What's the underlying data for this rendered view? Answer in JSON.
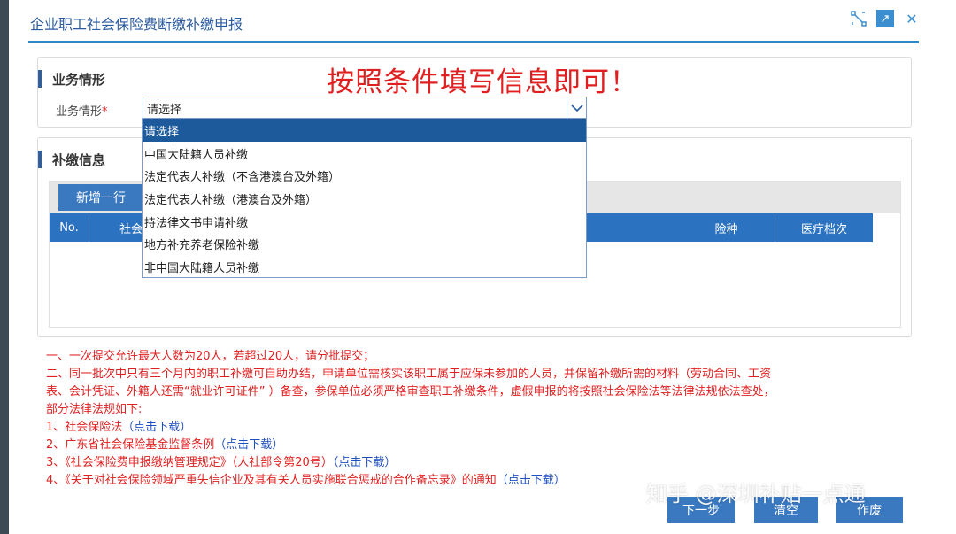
{
  "window": {
    "title": "企业职工社会保险费断缴补缴申报",
    "icons": [
      "resize-icon",
      "popout-icon",
      "close-icon"
    ]
  },
  "slogan": "按照条件填写信息即可！",
  "section1": {
    "title": "业务情形",
    "field_label": "业务情形",
    "required_mark": "*",
    "selected_value": "请选择",
    "options": [
      "请选择",
      "中国大陆籍人员补缴",
      "法定代表人补缴（不含港澳台及外籍）",
      "法定代表人补缴（港澳台及外籍）",
      "持法律文书申请补缴",
      "地方补充养老保险补缴",
      "非中国大陆籍人员补缴"
    ]
  },
  "section2": {
    "title": "补缴信息",
    "add_row_button": "新增一行",
    "columns": [
      "No.",
      "社会",
      "险种",
      "医疗档次"
    ]
  },
  "notes": {
    "line1": "一、一次提交允许最大人数为20人，若超过20人，请分批提交；",
    "line2a": "二、同一批次中只有三个月内的职工补缴可自助办结，申请单位需核实该职工属于应保未参加的人员，并保留补缴所需的材料（劳动合同、工资",
    "line2b": "表、会计凭证、外籍人还需“就业许可证件” ）备查，参保单位必须严格审查职工补缴条件，虚假申报的将按照社会保险法等法律法规依法查处，",
    "line2c": "部分法律法规如下:",
    "law1": "1、社会保险法",
    "law2": "2、广东省社会保险基金监督条例",
    "law3": "3、《社会保险费申报缴纳管理规定》（人社部令第20号）",
    "law4": "4、《关于对社会保险领域严重失信企业及其有关人员实施联合惩戒的合作备忘录》的通知",
    "download": "（点击下载）"
  },
  "buttons": {
    "next": "下一步",
    "clear": "清空",
    "void": "作废"
  },
  "watermark": "知乎 @深圳补贴一点通"
}
